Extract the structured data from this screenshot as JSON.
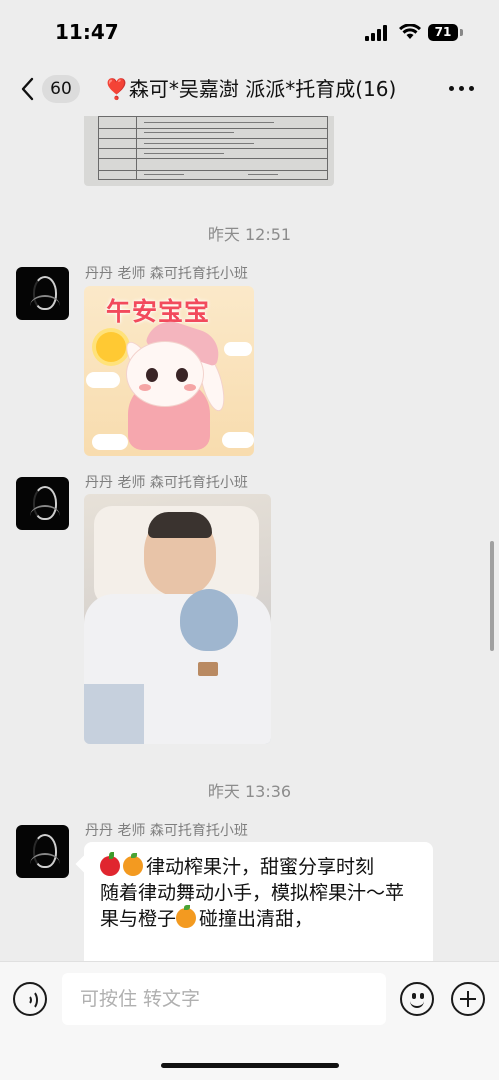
{
  "status_bar": {
    "time": "11:47",
    "battery": "71"
  },
  "header": {
    "unread_count": "60",
    "title": "❣️森可*吴嘉澍 派派*托育成(16)"
  },
  "messages": [
    {
      "type": "image",
      "description_icon": "document-photo"
    },
    {
      "type": "timestamp",
      "text": "昨天 12:51"
    },
    {
      "type": "sticker",
      "sender": "丹丹 老师 森可托育托小班",
      "sticker_text": "午安宝宝"
    },
    {
      "type": "photo",
      "sender": "丹丹 老师 森可托育托小班"
    },
    {
      "type": "timestamp",
      "text": "昨天 13:36"
    },
    {
      "type": "text",
      "sender": "丹丹 老师 森可托育托小班",
      "line1": "律动榨果汁，甜蜜分享时刻",
      "line2": "随着律动舞动小手，模拟榨果汁～苹果与橙子",
      "line3": "碰撞出清甜，"
    }
  ],
  "input_bar": {
    "placeholder": "可按住 转文字"
  },
  "colors": {
    "background": "#ededed",
    "bubble": "#ffffff",
    "meta_text": "#8c8c8c"
  }
}
